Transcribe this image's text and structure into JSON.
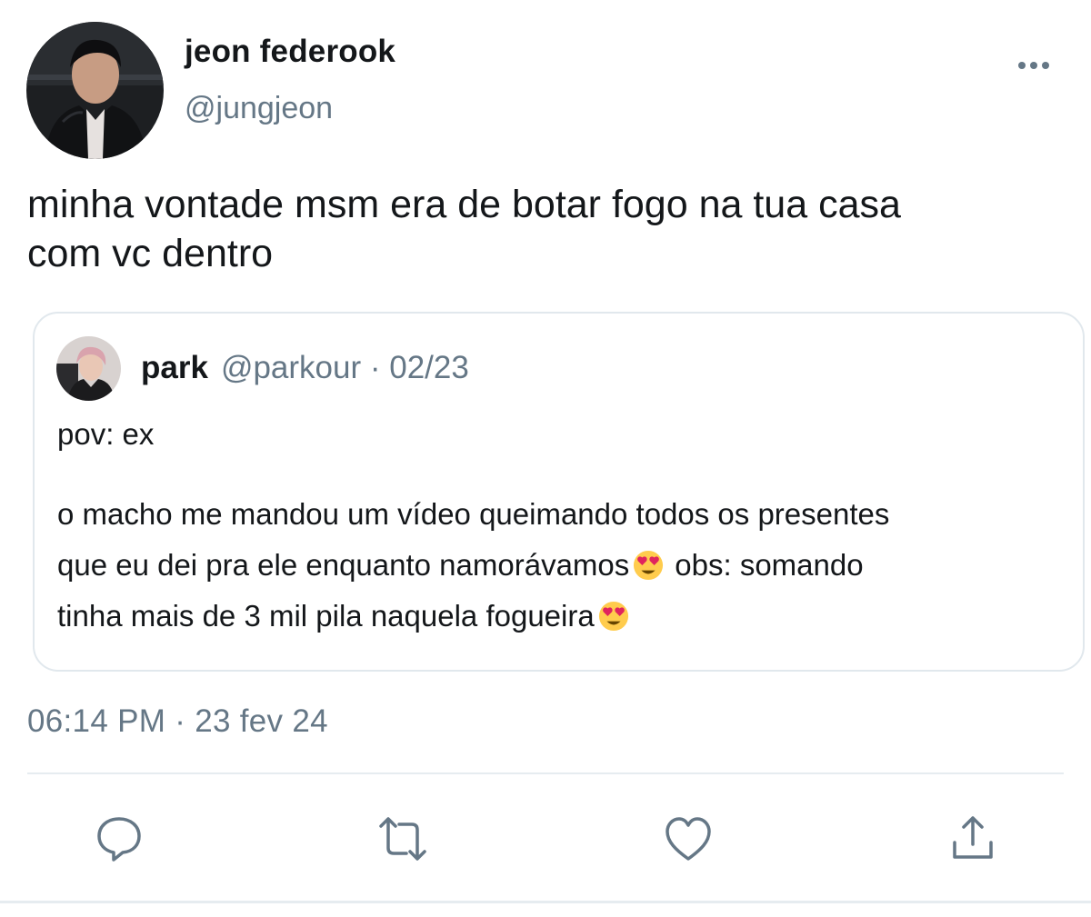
{
  "author": {
    "display_name": "jeon federook",
    "handle": "@jungjeon"
  },
  "tweet": {
    "text": "minha vontade msm era de botar fogo na tua casa\ncom vc dentro",
    "timestamp": "06:14 PM · 23 fev 24"
  },
  "quoted_tweet": {
    "display_name": "park",
    "handle_date": "@parkour · 02/23",
    "line1": "pov: ex",
    "line2": "o macho me mandou um vídeo queimando todos os presentes",
    "line3a": "que eu dei pra ele enquanto namorávamos",
    "line3b": "obs: somando",
    "line4": "tinha mais de 3 mil pila naquela fogueira",
    "emoji": "smiling-face-with-heart-eyes"
  },
  "icons": {
    "more": "more-horizontal-icon",
    "reply": "reply-icon",
    "retweet": "retweet-icon",
    "like": "heart-icon",
    "share": "share-icon"
  },
  "colors": {
    "primary_text": "#14171a",
    "secondary_text": "#657786",
    "border": "#e1e8ed",
    "emoji_yellow": "#ffcc4d",
    "emoji_heart": "#e0245e"
  }
}
